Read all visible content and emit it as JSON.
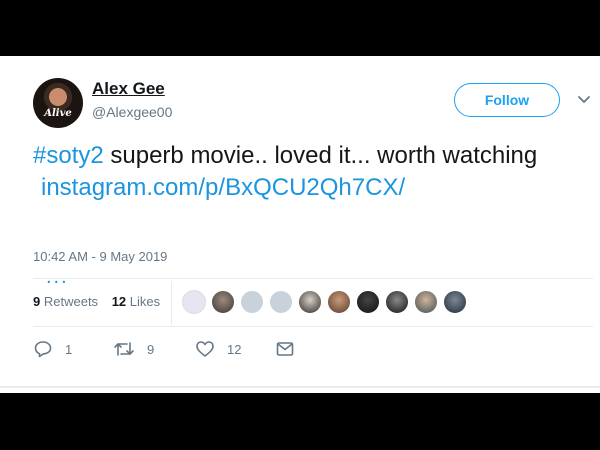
{
  "tweet": {
    "author": {
      "display_name": "Alex Gee",
      "handle": "@Alexgee00",
      "avatar_logo_text": "Alive"
    },
    "follow_label": "Follow",
    "text": {
      "hashtag": "#soty2",
      "body": " superb movie.. loved it... worth watching",
      "link": "instagram.com/p/BxQCU2Qh7CX/",
      "ellipsis": "..."
    },
    "timestamp": "10:42 AM - 9 May 2019",
    "stats": {
      "retweets_count": "9",
      "retweets_label": "Retweets",
      "likes_count": "12",
      "likes_label": "Likes"
    },
    "actions": {
      "reply_count": "1",
      "retweet_count": "9",
      "like_count": "12"
    },
    "colors": {
      "accent": "#1da1f2",
      "link": "#1b95e0",
      "muted": "#657786",
      "text": "#14171a"
    }
  }
}
